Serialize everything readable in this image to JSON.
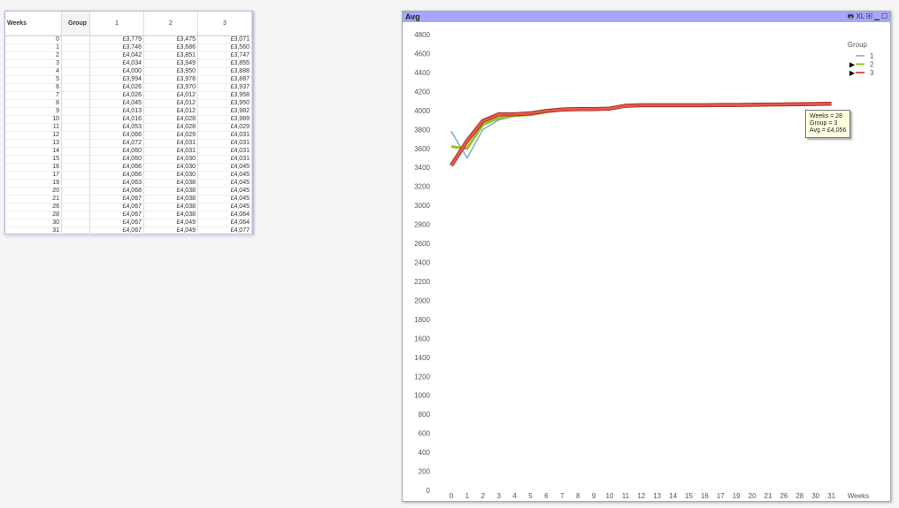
{
  "table": {
    "headers": {
      "weeks": "Weeks",
      "group": "Group",
      "cols": [
        "1",
        "2",
        "3"
      ]
    },
    "rows": [
      [
        "0",
        "£3,779",
        "£3,475",
        "£3,071"
      ],
      [
        "1",
        "£3,746",
        "£3,686",
        "£3,560"
      ],
      [
        "2",
        "£4,042",
        "£3,851",
        "£3,747"
      ],
      [
        "3",
        "£4,034",
        "£3,949",
        "£3,855"
      ],
      [
        "4",
        "£4,000",
        "£3,950",
        "£3,888"
      ],
      [
        "5",
        "£3,994",
        "£3,978",
        "£3,887"
      ],
      [
        "6",
        "£4,026",
        "£3,970",
        "£3,937"
      ],
      [
        "7",
        "£4,026",
        "£4,012",
        "£3,958"
      ],
      [
        "8",
        "£4,045",
        "£4,012",
        "£3,950"
      ],
      [
        "9",
        "£4,013",
        "£4,012",
        "£3,982"
      ],
      [
        "10",
        "£4,016",
        "£4,028",
        "£3,989"
      ],
      [
        "11",
        "£4,053",
        "£4,028",
        "£4,029"
      ],
      [
        "12",
        "£4,066",
        "£4,029",
        "£4,031"
      ],
      [
        "13",
        "£4,072",
        "£4,031",
        "£4,031"
      ],
      [
        "14",
        "£4,060",
        "£4,031",
        "£4,031"
      ],
      [
        "15",
        "£4,060",
        "£4,030",
        "£4,031"
      ],
      [
        "16",
        "£4,066",
        "£4,030",
        "£4,045"
      ],
      [
        "17",
        "£4,066",
        "£4,030",
        "£4,045"
      ],
      [
        "19",
        "£4,063",
        "£4,038",
        "£4,045"
      ],
      [
        "20",
        "£4,068",
        "£4,038",
        "£4,045"
      ],
      [
        "21",
        "£4,067",
        "£4,038",
        "£4,045"
      ],
      [
        "26",
        "£4,067",
        "£4,038",
        "£4,045"
      ],
      [
        "28",
        "£4,067",
        "£4,038",
        "£4,064"
      ],
      [
        "30",
        "£4,067",
        "£4,049",
        "£4,064"
      ],
      [
        "31",
        "£4,067",
        "£4,049",
        "£4,077"
      ]
    ]
  },
  "chart": {
    "title": "Avg",
    "caption_icons": "🖶 XL ▣ ▁ ☐",
    "tooltip": [
      "Weeks = 28",
      "Group = 3",
      "Avg = £4,056"
    ]
  },
  "chart_data": {
    "type": "line",
    "title": "Avg",
    "xlabel": "Weeks",
    "ylabel": "",
    "ylim": [
      0,
      4800
    ],
    "yticks": [
      0,
      200,
      400,
      600,
      800,
      1000,
      1200,
      1400,
      1600,
      1800,
      2000,
      2200,
      2400,
      2600,
      2800,
      3000,
      3200,
      3400,
      3600,
      3800,
      4000,
      4200,
      4400,
      4600,
      4800
    ],
    "categories": [
      "0",
      "1",
      "2",
      "3",
      "4",
      "5",
      "6",
      "7",
      "8",
      "9",
      "10",
      "11",
      "12",
      "13",
      "14",
      "15",
      "16",
      "17",
      "19",
      "20",
      "21",
      "26",
      "28",
      "30",
      "31"
    ],
    "legend_title": "Group",
    "legend_position": "top-right",
    "series": [
      {
        "name": "1",
        "color": "#7fa6d8",
        "values": [
          3780,
          3500,
          3800,
          3900,
          3940,
          3950,
          3980,
          4000,
          4000,
          4005,
          4010,
          4040,
          4050,
          4050,
          4050,
          4050,
          4050,
          4055,
          4055,
          4060,
          4060,
          4062,
          4065,
          4068,
          4070
        ]
      },
      {
        "name": "2",
        "color": "#99c31e",
        "values": [
          3620,
          3600,
          3850,
          3920,
          3945,
          3955,
          3985,
          4005,
          4008,
          4010,
          4015,
          4045,
          4052,
          4052,
          4052,
          4052,
          4052,
          4056,
          4056,
          4060,
          4060,
          4062,
          4065,
          4068,
          4070
        ]
      },
      {
        "name": "3",
        "color": "#e8554a",
        "values": [
          3420,
          3680,
          3890,
          3960,
          3960,
          3970,
          3995,
          4010,
          4015,
          4015,
          4020,
          4050,
          4055,
          4055,
          4055,
          4055,
          4055,
          4058,
          4058,
          4060,
          4062,
          4064,
          4066,
          4068,
          4072
        ]
      }
    ]
  }
}
